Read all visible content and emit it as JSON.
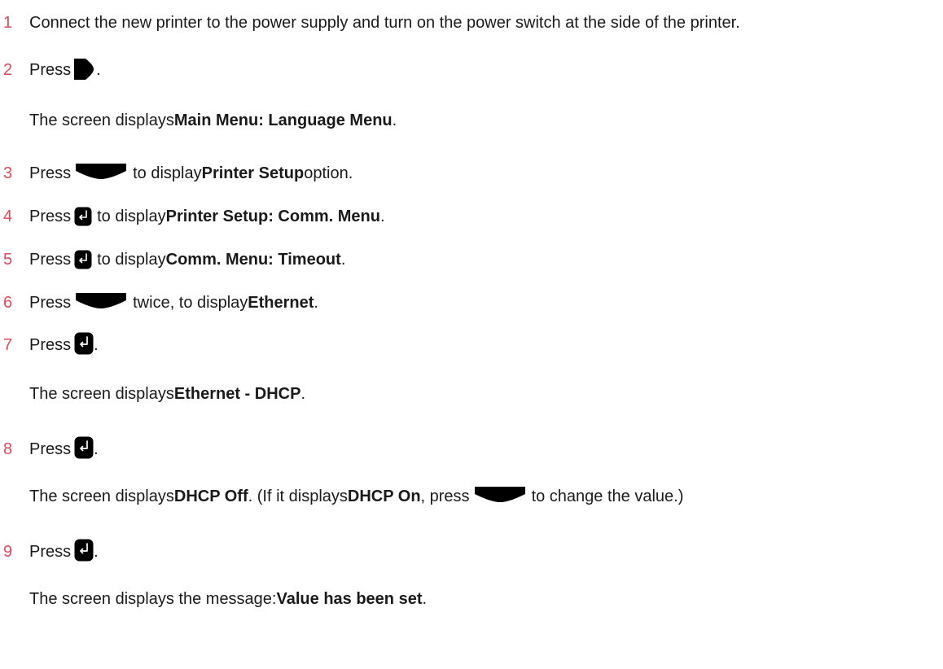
{
  "steps": [
    {
      "num": "1",
      "parts": {
        "a": "Connect the new printer to the power supply and turn on the power switch at the side of the printer."
      }
    },
    {
      "num": "2",
      "parts": {
        "a": "Press",
        "b": "."
      },
      "note": {
        "a": "The screen displays ",
        "b": "Main Menu: Language Menu",
        "c": "."
      }
    },
    {
      "num": "3",
      "parts": {
        "a": "Press",
        "b": "to display ",
        "c": "Printer Setup",
        "d": " option."
      }
    },
    {
      "num": "4",
      "parts": {
        "a": "Press",
        "b": "to display ",
        "c": "Printer Setup: Comm. Menu",
        "d": "."
      }
    },
    {
      "num": "5",
      "parts": {
        "a": "Press",
        "b": "to display ",
        "c": "Comm. Menu: Timeout",
        "d": "."
      }
    },
    {
      "num": "6",
      "parts": {
        "a": "Press",
        "b": "twice, to display ",
        "c": "Ethernet",
        "d": "."
      }
    },
    {
      "num": "7",
      "parts": {
        "a": "Press",
        "b": "."
      },
      "note": {
        "a": "The screen displays ",
        "b": "Ethernet - DHCP",
        "c": "."
      }
    },
    {
      "num": "8",
      "parts": {
        "a": "Press",
        "b": "."
      },
      "note": {
        "a": "The screen displays ",
        "b": "DHCP Off",
        "c": ". (If it displays ",
        "d": "DHCP On",
        "e": ", press ",
        "f": "to change the value.)"
      }
    },
    {
      "num": "9",
      "parts": {
        "a": "Press",
        "b": "."
      },
      "note": {
        "a": "The screen displays the message: ",
        "b": "Value has been set",
        "c": "."
      }
    }
  ],
  "icons": {
    "power": "right-arrow-key-icon",
    "down": "down-key-icon",
    "enter": "enter-key-icon"
  },
  "colors": {
    "step_number": "#e2495a",
    "text": "#1a1a1a",
    "key": "#000000"
  }
}
